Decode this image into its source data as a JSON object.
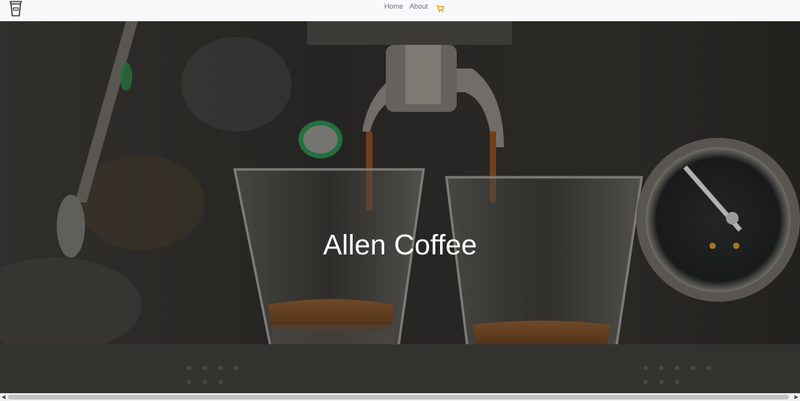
{
  "nav": {
    "logo_icon": "coffee-cup-logo-icon",
    "links": [
      {
        "label": "Home"
      },
      {
        "label": "About"
      }
    ],
    "cart_icon": "shopping-cart-icon",
    "cart_color": "#f0a020"
  },
  "hero": {
    "title": "Allen Coffee",
    "background": "espresso-machine-photo"
  },
  "scrollbar": {
    "left_arrow": "◀",
    "right_arrow": "▶"
  }
}
